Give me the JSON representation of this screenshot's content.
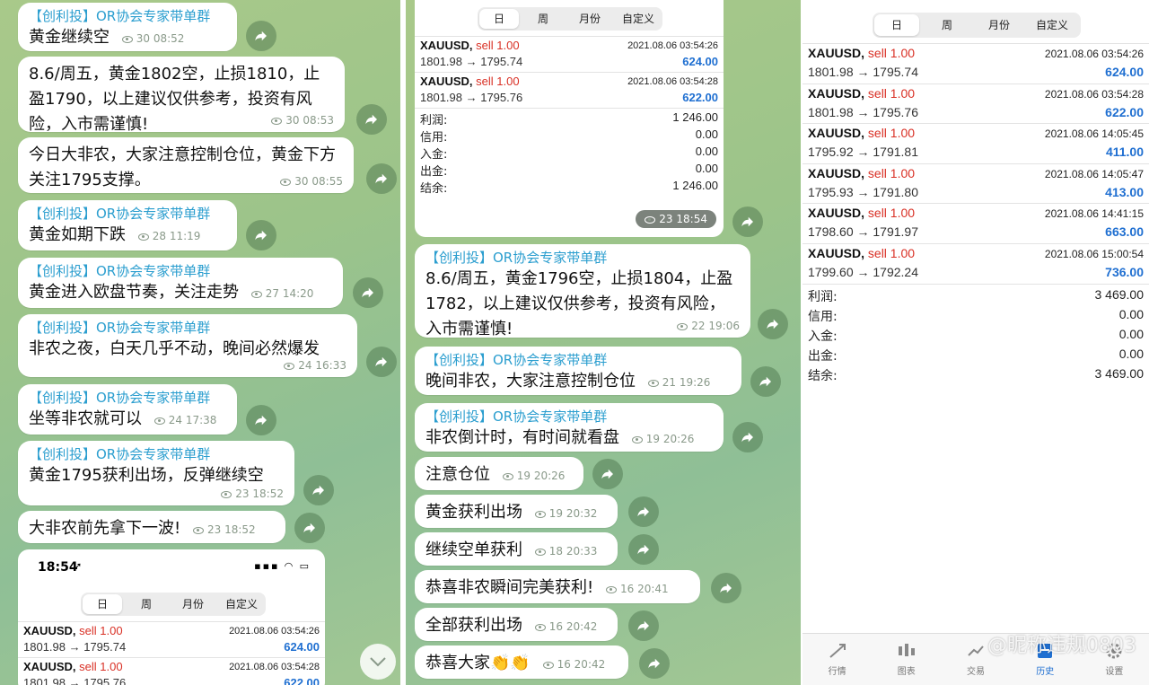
{
  "left_chat": {
    "messages": [
      {
        "sender": "【创利投】OR协会专家带单群",
        "text": "黄金继续空",
        "views": "30",
        "time": "08:52"
      },
      {
        "sender": "",
        "text": "8.6/周五，黄金1802空，止损1810，止盈1790，以上建议仅供参考，投资有风险，入市需谨慎!",
        "views": "30",
        "time": "08:53"
      },
      {
        "sender": "",
        "text": "今日大非农，大家注意控制仓位，黄金下方关注1795支撑。",
        "views": "30",
        "time": "08:55"
      },
      {
        "sender": "【创利投】OR协会专家带单群",
        "text": "黄金如期下跌",
        "views": "28",
        "time": "11:19"
      },
      {
        "sender": "【创利投】OR协会专家带单群",
        "text": "黄金进入欧盘节奏，关注走势",
        "views": "27",
        "time": "14:20"
      },
      {
        "sender": "【创利投】OR协会专家带单群",
        "text": "非农之夜，白天几乎不动，晚间必然爆发",
        "views": "24",
        "time": "16:33"
      },
      {
        "sender": "【创利投】OR协会专家带单群",
        "text": "坐等非农就可以",
        "views": "24",
        "time": "17:38"
      },
      {
        "sender": "【创利投】OR协会专家带单群",
        "text": "黄金1795获利出场，反弹继续空",
        "views": "23",
        "time": "18:52"
      },
      {
        "sender": "",
        "text": "大非农前先拿下一波!",
        "views": "23",
        "time": "18:52"
      }
    ],
    "screenshot": {
      "status_time": "18:54",
      "tabs": [
        "日",
        "周",
        "月份",
        "自定义"
      ],
      "trades": [
        {
          "symbol": "XAUUSD,",
          "side": "sell 1.00",
          "date": "2021.08.06 03:54:26",
          "prices": "1801.98 → 1795.74",
          "profit": "624.00"
        },
        {
          "symbol": "XAUUSD,",
          "side": "sell 1.00",
          "date": "2021.08.06 03:54:28",
          "prices": "1801.98 → 1795.76",
          "profit": "622.00"
        }
      ]
    }
  },
  "mid_chat": {
    "screenshot": {
      "tabs": [
        "日",
        "周",
        "月份",
        "自定义"
      ],
      "trades": [
        {
          "symbol": "XAUUSD,",
          "side": "sell 1.00",
          "date": "2021.08.06 03:54:26",
          "prices": "1801.98 → 1795.74",
          "profit": "624.00"
        },
        {
          "symbol": "XAUUSD,",
          "side": "sell 1.00",
          "date": "2021.08.06 03:54:28",
          "prices": "1801.98 → 1795.76",
          "profit": "622.00"
        }
      ],
      "summary": [
        {
          "label": "利润:",
          "value": "1 246.00"
        },
        {
          "label": "信用:",
          "value": "0.00"
        },
        {
          "label": "入金:",
          "value": "0.00"
        },
        {
          "label": "出金:",
          "value": "0.00"
        },
        {
          "label": "结余:",
          "value": "1 246.00"
        }
      ],
      "views": "23",
      "time": "18:54"
    },
    "messages": [
      {
        "sender": "【创利投】OR协会专家带单群",
        "text": "8.6/周五，黄金1796空，止损1804，止盈1782，以上建议仅供参考，投资有风险，入市需谨慎!",
        "views": "22",
        "time": "19:06"
      },
      {
        "sender": "【创利投】OR协会专家带单群",
        "text": "晚间非农，大家注意控制仓位",
        "views": "21",
        "time": "19:26"
      },
      {
        "sender": "【创利投】OR协会专家带单群",
        "text": "非农倒计时，有时间就看盘",
        "views": "19",
        "time": "20:26"
      },
      {
        "sender": "",
        "text": "注意仓位",
        "views": "19",
        "time": "20:26"
      },
      {
        "sender": "",
        "text": "黄金获利出场",
        "views": "19",
        "time": "20:32"
      },
      {
        "sender": "",
        "text": "继续空单获利",
        "views": "18",
        "time": "20:33"
      },
      {
        "sender": "",
        "text": "恭喜非农瞬间完美获利!",
        "views": "16",
        "time": "20:41"
      },
      {
        "sender": "",
        "text": "全部获利出场",
        "views": "16",
        "time": "20:42"
      },
      {
        "sender": "",
        "text": "恭喜大家👏👏",
        "views": "16",
        "time": "20:42"
      }
    ]
  },
  "right_app": {
    "tabs": [
      "日",
      "周",
      "月份",
      "自定义"
    ],
    "trades": [
      {
        "symbol": "XAUUSD,",
        "side": "sell 1.00",
        "date": "2021.08.06 03:54:26",
        "prices": "1801.98 → 1795.74",
        "profit": "624.00"
      },
      {
        "symbol": "XAUUSD,",
        "side": "sell 1.00",
        "date": "2021.08.06 03:54:28",
        "prices": "1801.98 → 1795.76",
        "profit": "622.00"
      },
      {
        "symbol": "XAUUSD,",
        "side": "sell 1.00",
        "date": "2021.08.06 14:05:45",
        "prices": "1795.92 → 1791.81",
        "profit": "411.00"
      },
      {
        "symbol": "XAUUSD,",
        "side": "sell 1.00",
        "date": "2021.08.06 14:05:47",
        "prices": "1795.93 → 1791.80",
        "profit": "413.00"
      },
      {
        "symbol": "XAUUSD,",
        "side": "sell 1.00",
        "date": "2021.08.06 14:41:15",
        "prices": "1798.60 → 1791.97",
        "profit": "663.00"
      },
      {
        "symbol": "XAUUSD,",
        "side": "sell 1.00",
        "date": "2021.08.06 15:00:54",
        "prices": "1799.60 → 1792.24",
        "profit": "736.00"
      }
    ],
    "summary": [
      {
        "label": "利润:",
        "value": "3 469.00"
      },
      {
        "label": "信用:",
        "value": "0.00"
      },
      {
        "label": "入金:",
        "value": "0.00"
      },
      {
        "label": "出金:",
        "value": "0.00"
      },
      {
        "label": "结余:",
        "value": "3 469.00"
      }
    ],
    "nav": [
      {
        "label": "行情",
        "icon": "quotes-icon"
      },
      {
        "label": "图表",
        "icon": "chart-icon"
      },
      {
        "label": "交易",
        "icon": "trade-icon"
      },
      {
        "label": "历史",
        "icon": "history-icon"
      },
      {
        "label": "设置",
        "icon": "settings-icon"
      }
    ],
    "active_nav": "历史",
    "watermark": "@昵称违规0803"
  },
  "colors": {
    "sender": "#2b9ecf",
    "sell": "#d93025",
    "profit": "#1f6fd1",
    "chat_bg": "#9cc48a"
  }
}
